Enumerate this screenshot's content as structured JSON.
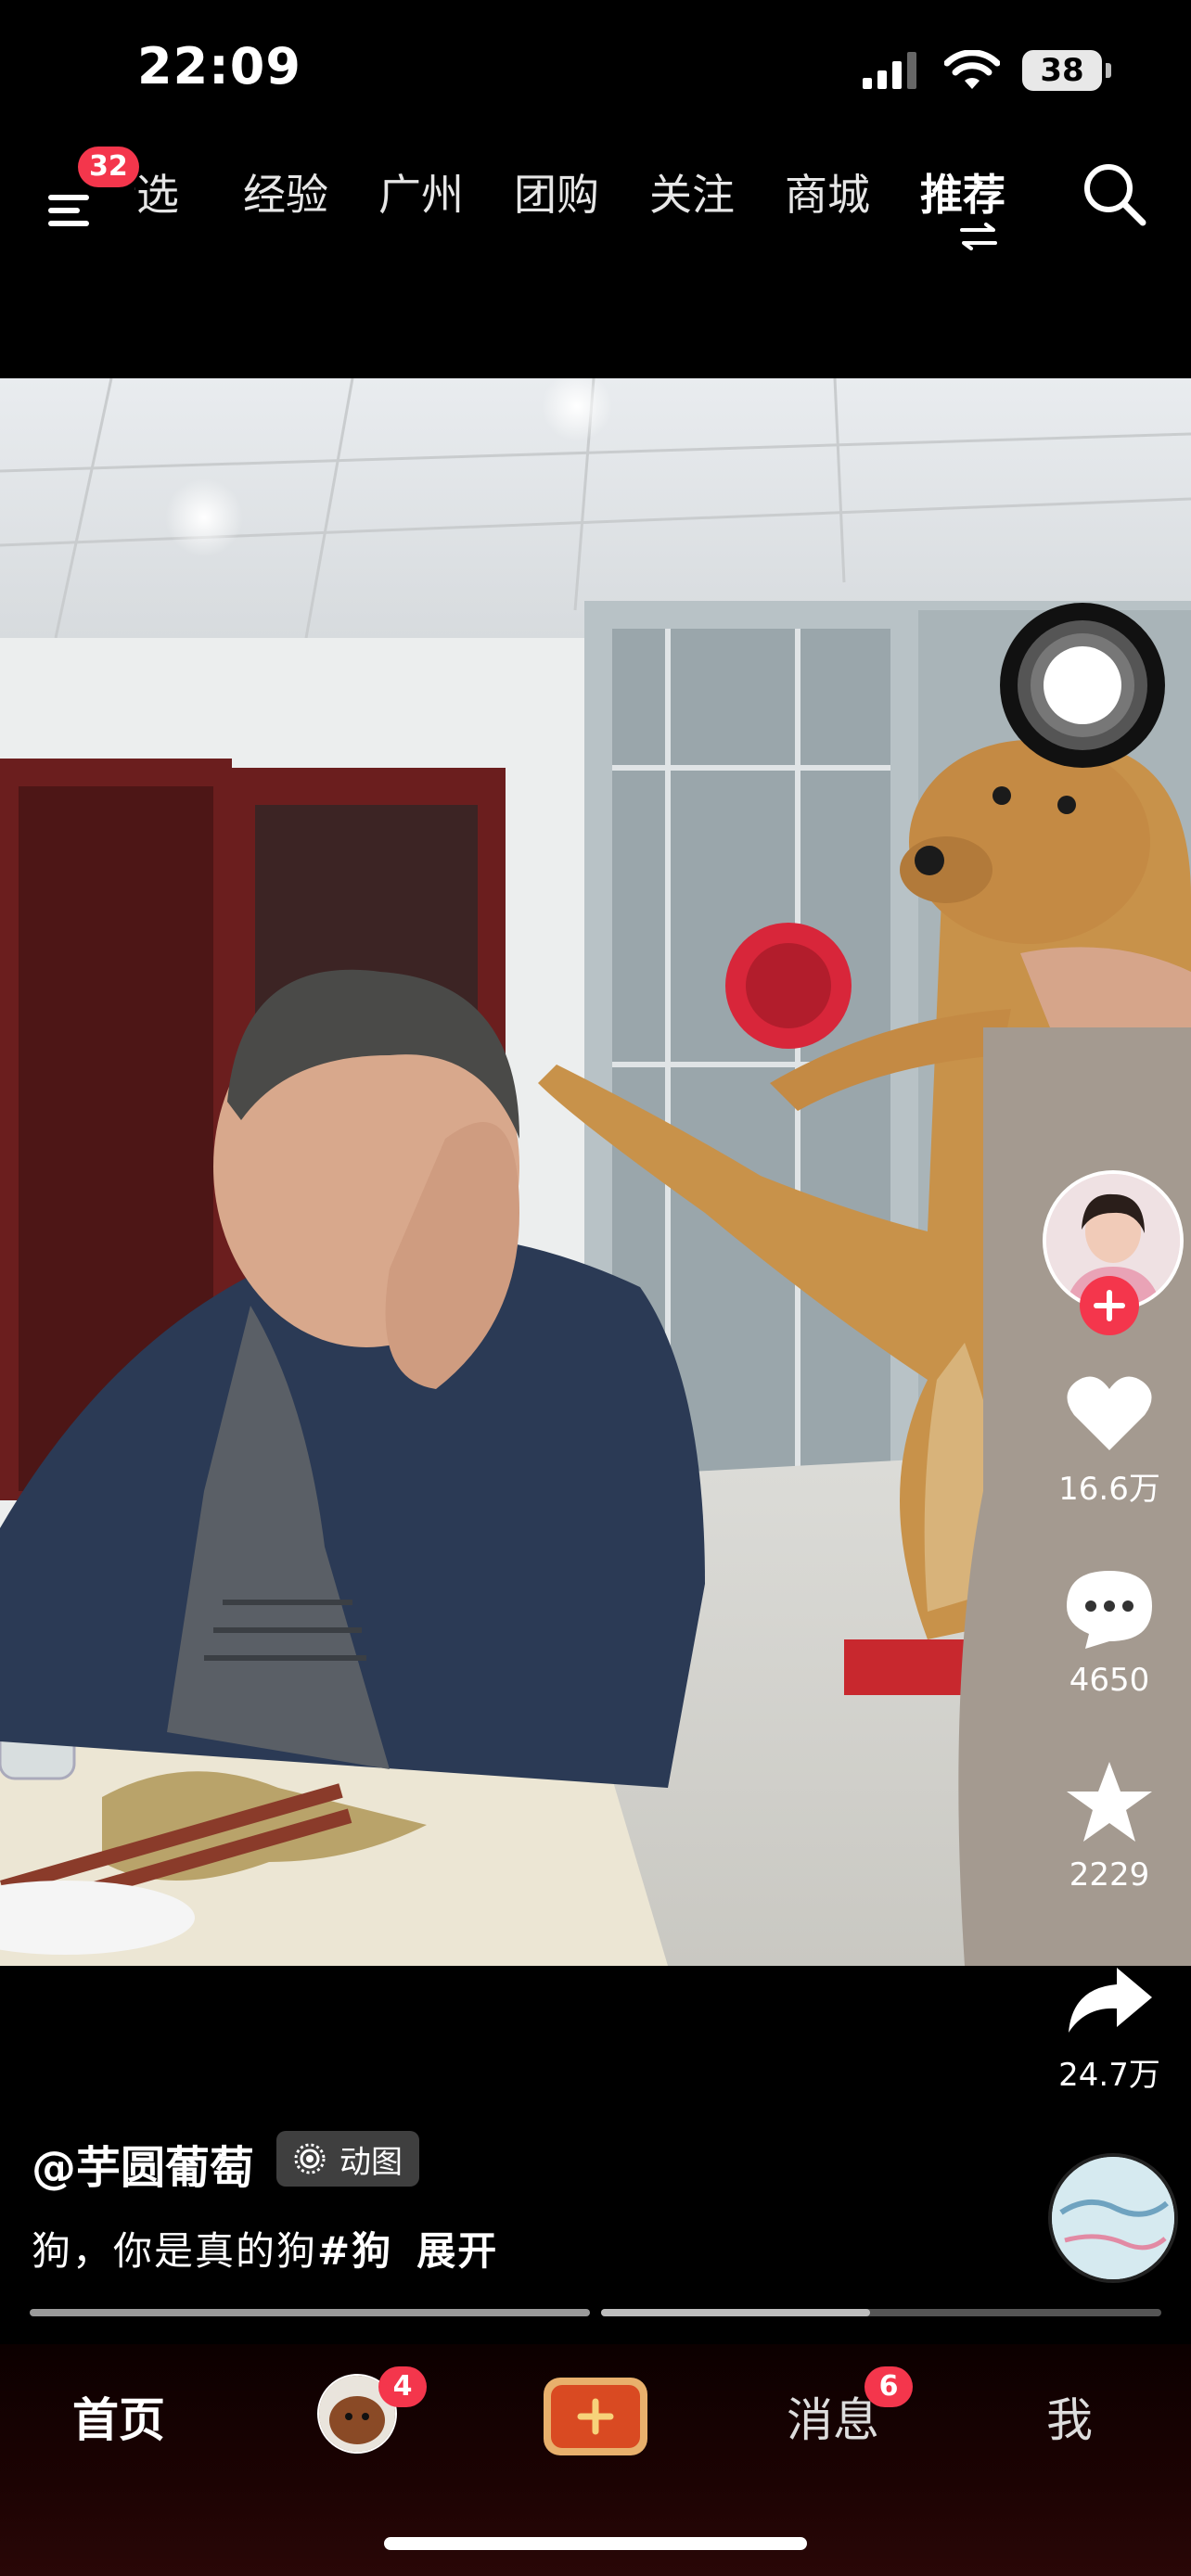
{
  "status_bar": {
    "time": "22:09",
    "battery": "38",
    "icons": [
      "cellular-signal-icon",
      "wifi-icon",
      "battery-icon"
    ]
  },
  "top_nav": {
    "menu_badge": "32",
    "tabs": [
      "精选",
      "经验",
      "广州",
      "团购",
      "关注",
      "商城",
      "推荐"
    ],
    "first_tab_visible": "精选",
    "active_tab": "推荐",
    "icons": [
      "menu-icon",
      "swap-icon",
      "search-icon"
    ]
  },
  "actions": {
    "likes": "16.6万",
    "comments": "4650",
    "favorites": "2229",
    "shares": "24.7万"
  },
  "post": {
    "author": "@芋圆葡萄",
    "tag": "动图",
    "description_text": "狗，你是真的狗",
    "hashtag": "#狗",
    "expand": "展开"
  },
  "playback": {
    "segment_2_progress": 0.48
  },
  "bottom_nav": {
    "home": "首页",
    "friends_badge": "4",
    "messages": "消息",
    "messages_badge": "6",
    "me": "我"
  },
  "colors": {
    "accent_red": "#f4364c",
    "background": "#000000",
    "plus_button": "#d94a22"
  }
}
